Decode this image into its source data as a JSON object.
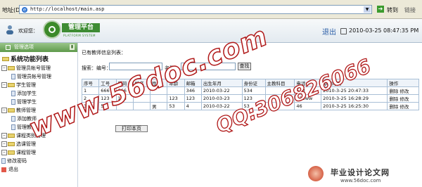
{
  "address_bar": {
    "label": "地址(D)",
    "url": "http://localhost/main.asp",
    "go_label": "转到",
    "links_label": "链接"
  },
  "header": {
    "welcome": "欢迎您：",
    "logo_text": "管理平台",
    "logo_sub": "PLATFORM SYSTEM",
    "logout": "退出",
    "datetime": "2010-03-25 08:47:35 PM"
  },
  "sidebar": {
    "title": "管理选项",
    "root": "系统功能列表",
    "items": [
      {
        "label": "管理员帐号管理",
        "level": 1,
        "type": "folder"
      },
      {
        "label": "管理员帐号管理",
        "level": 2,
        "type": "page"
      },
      {
        "label": "学生管理",
        "level": 1,
        "type": "folder"
      },
      {
        "label": "添加学生",
        "level": 2,
        "type": "page"
      },
      {
        "label": "管理学生",
        "level": 2,
        "type": "page"
      },
      {
        "label": "教师管理",
        "level": 1,
        "type": "folder"
      },
      {
        "label": "添加教师",
        "level": 2,
        "type": "page"
      },
      {
        "label": "管理教师",
        "level": 2,
        "type": "page"
      },
      {
        "label": "课程类别管理",
        "level": 1,
        "type": "folder"
      },
      {
        "label": "选课管理",
        "level": 1,
        "type": "folder"
      },
      {
        "label": "课程管理",
        "level": 1,
        "type": "folder"
      },
      {
        "label": "修改密码",
        "level": 1,
        "type": "page"
      },
      {
        "label": "退出",
        "level": 1,
        "type": "exit"
      }
    ]
  },
  "main": {
    "list_title": "已有教师信息列表：",
    "search_label": "搜索：编号：",
    "name_label": "名称：",
    "search_button": "查找",
    "print_button": "打印本页",
    "table": {
      "headers": [
        "序号",
        "工号",
        "密码",
        "姓名",
        "性别",
        "年龄",
        "邮箱",
        "出生年月",
        "身份证",
        "主教科目",
        "电话",
        "添加时间",
        "操作"
      ],
      "rows": [
        [
          "1",
          "666",
          "666",
          "",
          "",
          "",
          "346",
          "2010-03-22",
          "534",
          "",
          "543",
          "2010-3-25 20:47:33",
          "删除 修改"
        ],
        [
          "2",
          "123",
          "123",
          "",
          "",
          "123",
          "123",
          "2010-03-23",
          "123",
          "",
          "123ww",
          "2010-3-25 16:28:29",
          "删除 修改"
        ],
        [
          "3",
          "54",
          "",
          "",
          "男",
          "53",
          "4",
          "2010-03-22",
          "53",
          "",
          "46",
          "2010-3-25 16:25:30",
          "删除 修改"
        ]
      ]
    }
  },
  "watermarks": {
    "site": "www.56doc.com",
    "qq": "QQ:306826066"
  },
  "footer_logo": {
    "text": "毕业设计论文网",
    "url": "www.56doc.com"
  }
}
